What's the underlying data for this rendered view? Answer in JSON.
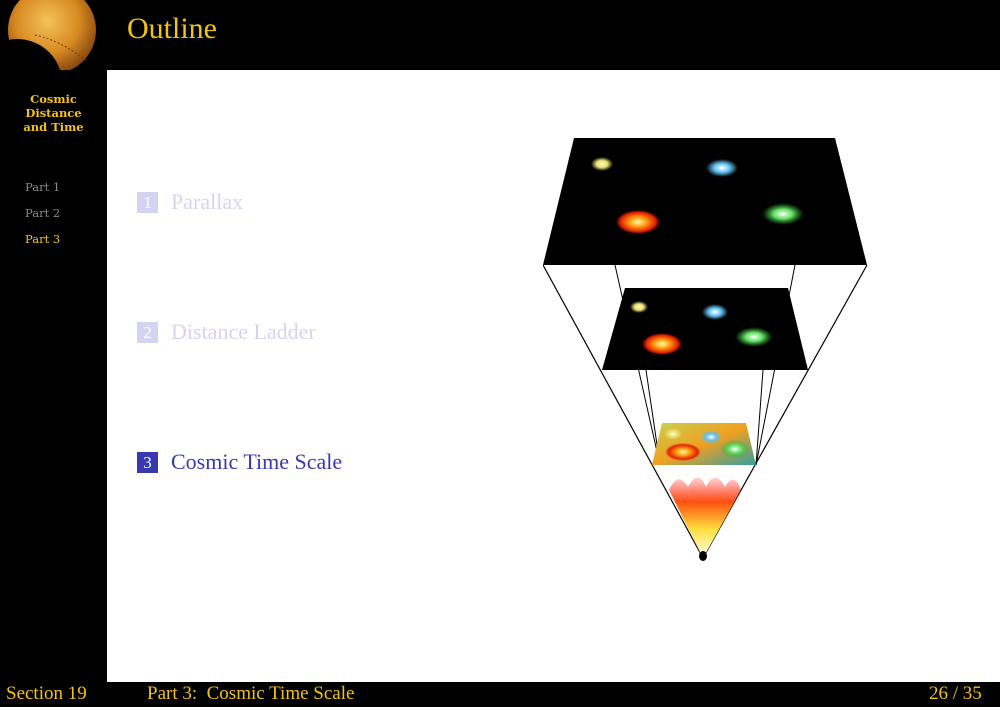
{
  "sidebar": {
    "title_lines": [
      "Cosmic",
      "Distance",
      "and Time"
    ],
    "parts": [
      {
        "label": "Part 1",
        "active": false
      },
      {
        "label": "Part 2",
        "active": false
      },
      {
        "label": "Part 3",
        "active": true
      }
    ]
  },
  "header": {
    "title": "Outline"
  },
  "toc": [
    {
      "num": "1",
      "label": "Parallax",
      "state": "dimmed"
    },
    {
      "num": "2",
      "label": "Distance Ladder",
      "state": "dimmed"
    },
    {
      "num": "3",
      "label": "Cosmic Time Scale",
      "state": "current"
    }
  ],
  "figure": {
    "icon": "expanding-universe-diagram"
  },
  "footer": {
    "section": "Section 19",
    "subtitle": "Part 3:  Cosmic Time Scale",
    "page": "26 / 35"
  },
  "colors": {
    "accent": "#f2c30f",
    "toc_current": "#3838b0",
    "toc_dimmed": "#d4d4f0"
  }
}
